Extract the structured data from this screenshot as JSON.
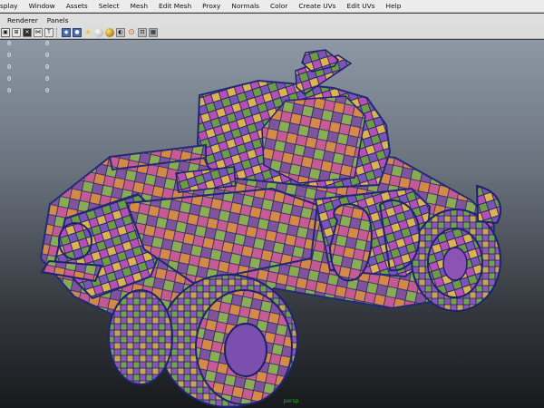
{
  "menubar": {
    "items": [
      "isplay",
      "Window",
      "Assets",
      "Select",
      "Mesh",
      "Edit Mesh",
      "Proxy",
      "Normals",
      "Color",
      "Create UVs",
      "Edit UVs",
      "Help"
    ]
  },
  "panel_menu": {
    "items": [
      "Renderer",
      "Panels"
    ]
  },
  "toolbar": {
    "buttons": [
      {
        "icon": "mask-tool-icon"
      },
      {
        "icon": "grid-toggle-icon"
      },
      {
        "icon": "wireframe-toggle-icon"
      },
      {
        "icon": "texture-display-icon"
      },
      {
        "icon": "text-icon"
      },
      {
        "icon": "shaded-cube-icon"
      },
      {
        "icon": "smooth-cube-icon"
      },
      {
        "icon": "light-icon"
      },
      {
        "icon": "material-sphere-icon"
      },
      {
        "icon": "default-material-icon"
      },
      {
        "icon": "xray-icon"
      },
      {
        "icon": "isolate-select-icon"
      },
      {
        "icon": "frame-all-icon"
      },
      {
        "icon": "grid-icon"
      }
    ]
  },
  "hud": {
    "rows": [
      {
        "left": "0",
        "right": "0"
      },
      {
        "left": "0",
        "right": "0"
      },
      {
        "left": "0",
        "right": "0"
      },
      {
        "left": "0",
        "right": "0"
      },
      {
        "left": "0",
        "right": "0"
      }
    ]
  },
  "viewport": {
    "camera_label": "persp",
    "model": "checker-textured armored car"
  }
}
